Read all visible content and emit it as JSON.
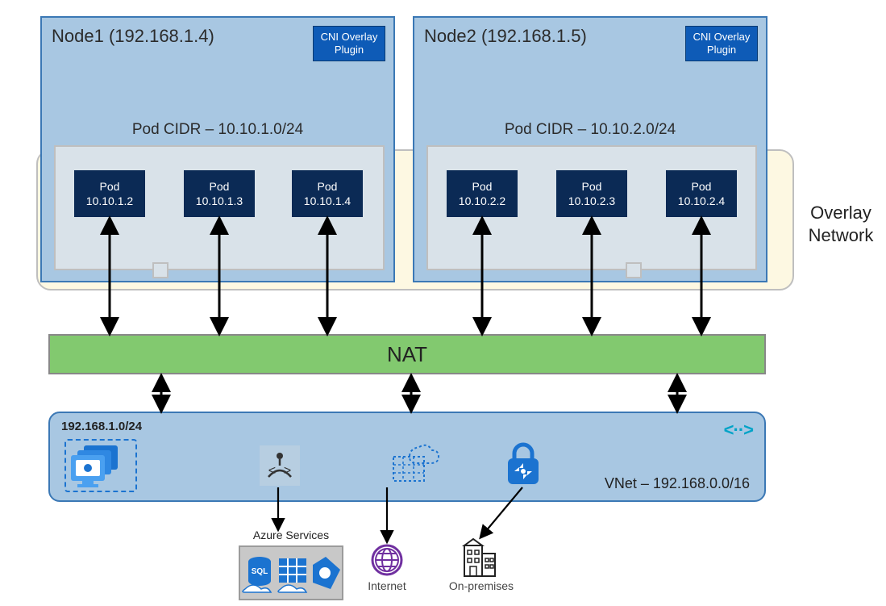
{
  "overlay_network_label": "Overlay Network",
  "nodes": [
    {
      "title": "Node1 (192.168.1.4)",
      "cni_label": "CNI Overlay Plugin",
      "pod_cidr_label": "Pod CIDR – 10.10.1.0/24",
      "pods": [
        {
          "name": "Pod",
          "ip": "10.10.1.2"
        },
        {
          "name": "Pod",
          "ip": "10.10.1.3"
        },
        {
          "name": "Pod",
          "ip": "10.10.1.4"
        }
      ]
    },
    {
      "title": "Node2 (192.168.1.5)",
      "cni_label": "CNI Overlay Plugin",
      "pod_cidr_label": "Pod CIDR – 10.10.2.0/24",
      "pods": [
        {
          "name": "Pod",
          "ip": "10.10.2.2"
        },
        {
          "name": "Pod",
          "ip": "10.10.2.3"
        },
        {
          "name": "Pod",
          "ip": "10.10.2.4"
        }
      ]
    }
  ],
  "nat_label": "NAT",
  "vnet": {
    "subnet_label": "192.168.1.0/24",
    "vnet_label": "VNet – 192.168.0.0/16"
  },
  "targets": {
    "azure_services_label": "Azure Services",
    "internet_label": "Internet",
    "onprem_label": "On-premises"
  },
  "icons": {
    "vm_group": "vm-scaleset-icon",
    "load_balancer": "load-balancer-icon",
    "storage": "storage-grid-icon",
    "vpn": "vpn-lock-icon",
    "vnet_peering": "vnet-peering-icon",
    "sql": "sql-db-icon",
    "table": "table-storage-icon",
    "cosmos": "cosmos-icon",
    "globe": "internet-globe-icon",
    "building": "building-icon"
  }
}
